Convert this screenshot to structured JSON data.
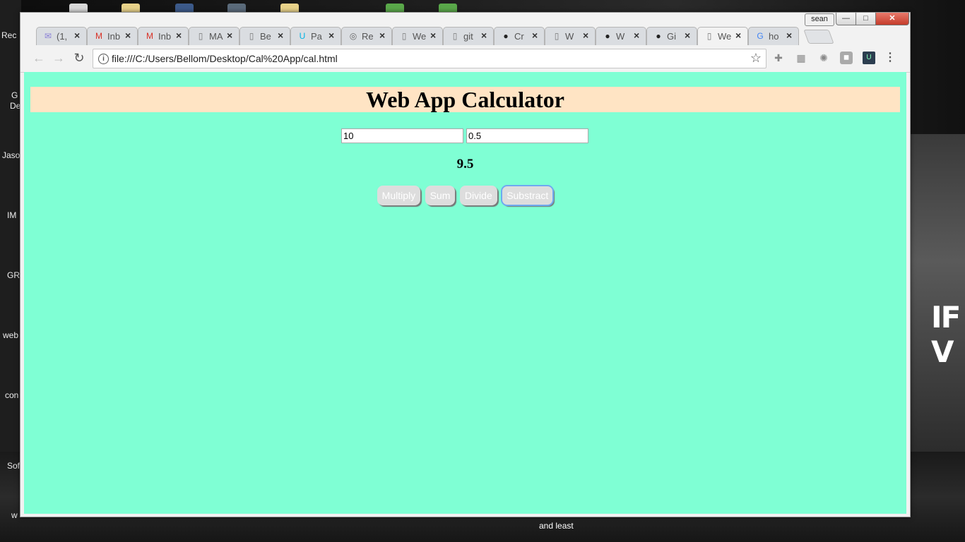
{
  "window": {
    "profile_name": "sean",
    "controls": {
      "minimize": "—",
      "maximize": "□",
      "close": "✕"
    }
  },
  "tabs": [
    {
      "label": "(1,",
      "icon": "mail-icon",
      "color": "#8a7fd6"
    },
    {
      "label": "Inb",
      "icon": "gmail-icon",
      "color": "#d93025"
    },
    {
      "label": "Inb",
      "icon": "gmail-icon",
      "color": "#d93025"
    },
    {
      "label": "MA",
      "icon": "page-icon",
      "color": "#777"
    },
    {
      "label": "Be",
      "icon": "page-icon",
      "color": "#777"
    },
    {
      "label": "Pa",
      "icon": "udacity-icon",
      "color": "#02b3e4"
    },
    {
      "label": "Re",
      "icon": "swirl-icon",
      "color": "#666"
    },
    {
      "label": "We",
      "icon": "page-icon",
      "color": "#777"
    },
    {
      "label": "git",
      "icon": "page-icon",
      "color": "#777"
    },
    {
      "label": "Cr",
      "icon": "github-icon",
      "color": "#222"
    },
    {
      "label": "W",
      "icon": "page-icon",
      "color": "#777"
    },
    {
      "label": "W",
      "icon": "github-icon",
      "color": "#222"
    },
    {
      "label": "Gi",
      "icon": "github-icon",
      "color": "#222"
    },
    {
      "label": "We",
      "icon": "page-icon",
      "color": "#777",
      "active": true
    },
    {
      "label": "ho",
      "icon": "google-icon",
      "color": "#4285f4"
    }
  ],
  "toolbar": {
    "url": "file:///C:/Users/Bellom/Desktop/Cal%20App/cal.html"
  },
  "page": {
    "title": "Web App Calculator",
    "input_a": "10",
    "input_b": "0.5",
    "result": "9.5",
    "buttons": {
      "multiply": "Multiply",
      "sum": "Sum",
      "divide": "Divide",
      "substract": "Substract"
    },
    "colors": {
      "background": "#7fffd4",
      "heading_bar": "#ffe4c4",
      "button": "#dddddd"
    }
  },
  "desktop": {
    "labels": [
      "Rec",
      "G",
      "De",
      "Jaso",
      "IM",
      "GR",
      "web",
      "con",
      "Sof",
      "w"
    ],
    "background_caption": "IF V",
    "background_text": "and least"
  }
}
